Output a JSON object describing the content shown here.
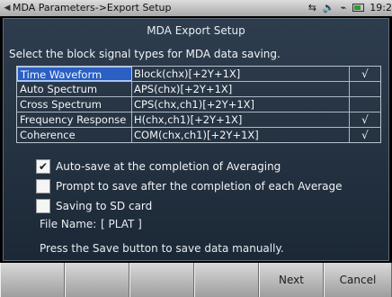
{
  "status_bar": {
    "breadcrumb": "MDA Parameters->Export Setup",
    "clock": "19:2"
  },
  "dialog": {
    "title": "MDA Export Setup",
    "instruction": "Select the block signal types for MDA data saving."
  },
  "signal_types": [
    {
      "name": "Time Waveform",
      "format": "Block(chx)[+2Y+1X]",
      "checked": true,
      "selected": true
    },
    {
      "name": "Auto Spectrum",
      "format": "APS(chx)[+2Y+1X]",
      "checked": false,
      "selected": false
    },
    {
      "name": "Cross Spectrum",
      "format": "CPS(chx,ch1)[+2Y+1X]",
      "checked": false,
      "selected": false
    },
    {
      "name": "Frequency Response",
      "format": "H(chx,ch1)[+2Y+1X]",
      "checked": true,
      "selected": false
    },
    {
      "name": "Coherence",
      "format": "COM(chx,ch1)[+2Y+1X]",
      "checked": true,
      "selected": false
    }
  ],
  "check_mark": "√",
  "options": [
    {
      "label": "Auto-save at the completion of Averaging",
      "checked": true
    },
    {
      "label": "Prompt to save after the completion of each Average",
      "checked": false
    },
    {
      "label": "Saving to SD card",
      "checked": false
    }
  ],
  "file_name": {
    "label": "File Name:",
    "value": "[ PLAT ]"
  },
  "save_hint": "Press the Save button to save data manually.",
  "softkeys": [
    "",
    "",
    "",
    "",
    "Next",
    "Cancel"
  ]
}
